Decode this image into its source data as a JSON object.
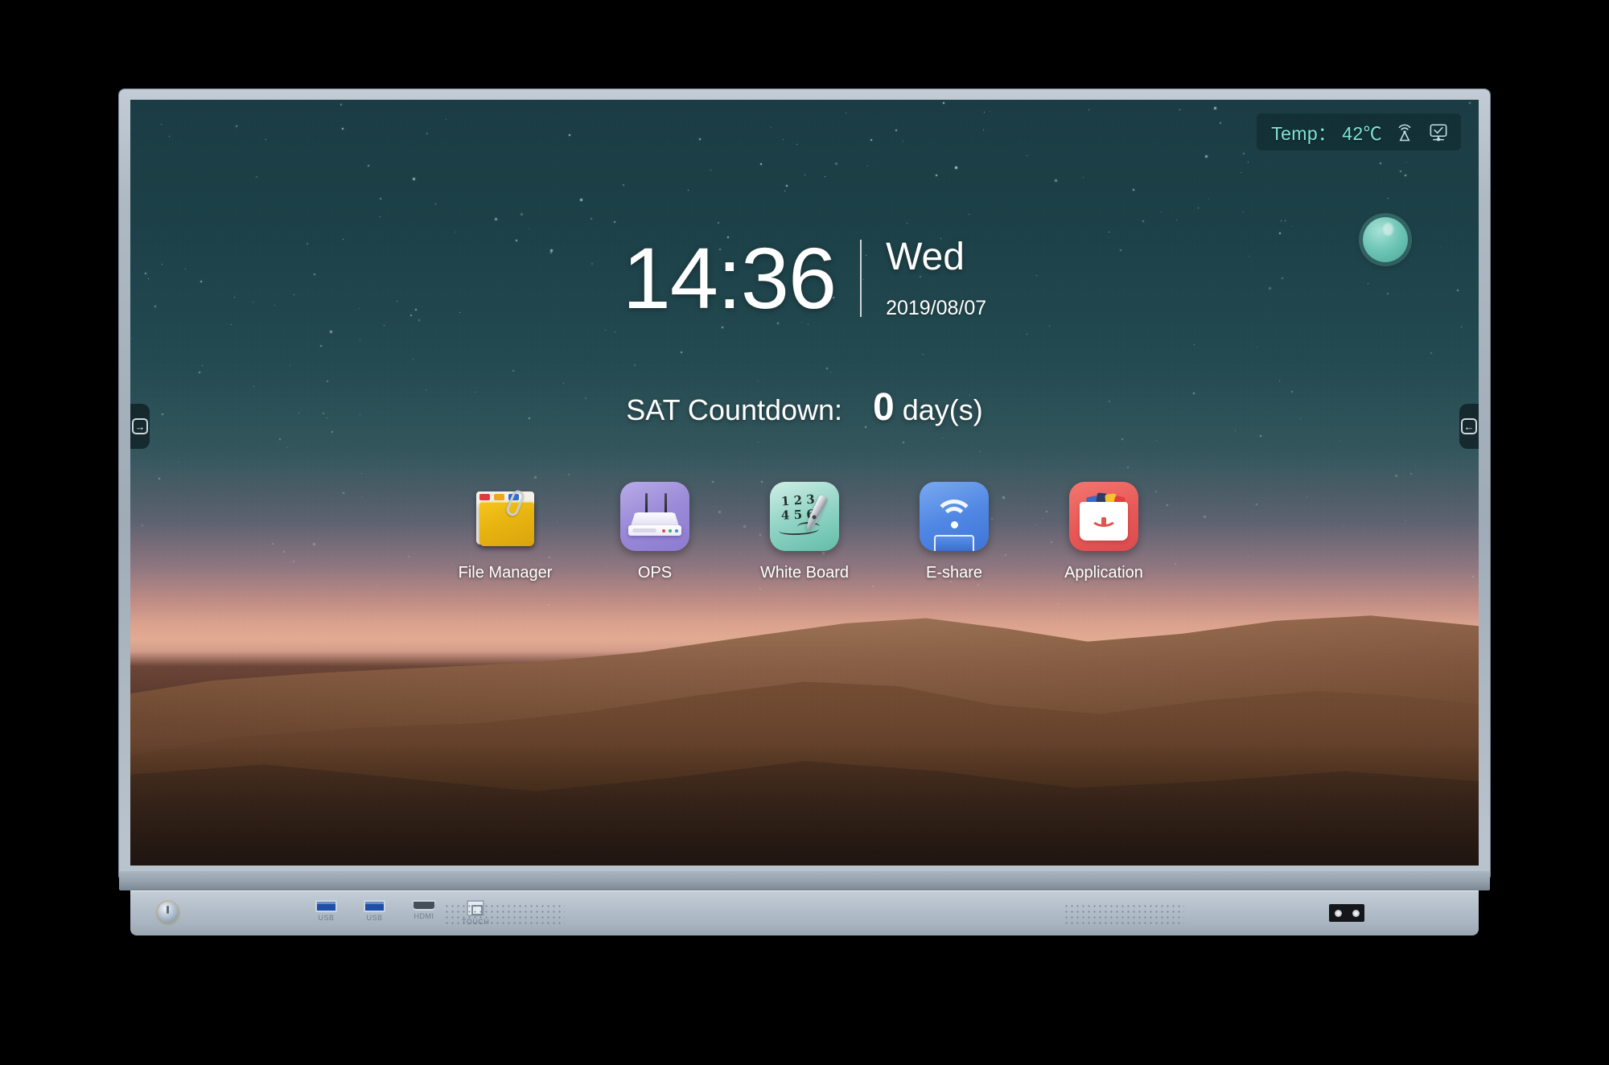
{
  "device": {
    "type": "interactive-flat-panel-display",
    "bezel_color": "#a9b5c1",
    "screen_bg_color": "#1d4148"
  },
  "statusbar": {
    "temp_label": "Temp：",
    "temp_value": "42℃",
    "temp_text": "Temp： 42℃",
    "accent_color": "#7fe3d6",
    "icons": [
      {
        "name": "wireless-broadcast-icon",
        "title": "Wireless broadcast"
      },
      {
        "name": "screen-status-icon",
        "title": "Display status OK"
      }
    ]
  },
  "floating_ball": {
    "name": "floating-assistant-ball",
    "color": "#6ec5b6"
  },
  "side_tabs": {
    "left": {
      "glyph": "→",
      "name": "side-tab-left"
    },
    "right": {
      "glyph": "←",
      "name": "side-tab-right"
    }
  },
  "clock": {
    "time": "14:36",
    "weekday": "Wed",
    "date": "2019/08/07"
  },
  "countdown": {
    "label": "SAT Countdown:",
    "value": "0",
    "unit": "day(s)"
  },
  "dock": {
    "apps": [
      {
        "label": "File Manager",
        "icon": "folder-paperclip-icon",
        "color": "#e8b411"
      },
      {
        "label": "OPS",
        "icon": "router-icon",
        "color": "#9b8ad8"
      },
      {
        "label": "White Board",
        "icon": "whiteboard-pen-icon",
        "color": "#8fd3c4",
        "glyphs": {
          "row1": "1 2 3",
          "row2": "4 5 6"
        }
      },
      {
        "label": "E-share",
        "icon": "wifi-cast-icon",
        "color": "#5188e4"
      },
      {
        "label": "Application",
        "icon": "app-store-bag-icon",
        "color": "#e85a58"
      }
    ]
  },
  "bottom_bar": {
    "power_button": "power-button",
    "ports": [
      {
        "label": "USB",
        "icon": "usb-port-icon"
      },
      {
        "label": "USB",
        "icon": "usb-port-icon"
      },
      {
        "label": "HDMI",
        "icon": "hdmi-port-icon"
      },
      {
        "label": "TOUCH",
        "icon": "touch-port-icon"
      }
    ],
    "speaker_grilles": 2,
    "ir_sensors": 2
  }
}
